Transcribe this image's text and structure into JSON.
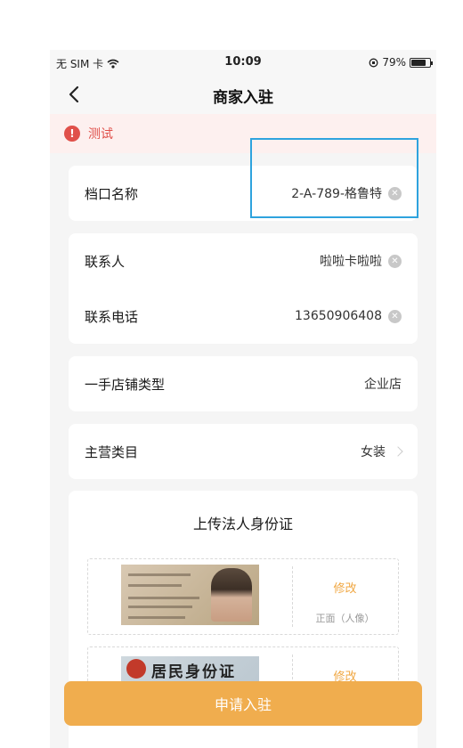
{
  "status_bar": {
    "carrier": "无 SIM 卡",
    "time": "10:09",
    "battery_text": "79%",
    "battery_level": 0.79
  },
  "nav": {
    "title": "商家入驻"
  },
  "notice": {
    "icon_text": "!",
    "text": "测试"
  },
  "stall": {
    "label": "档口名称",
    "value": "2-A-789-格鲁特"
  },
  "contact": {
    "name_label": "联系人",
    "name_value": "啦啦卡啦啦",
    "phone_label": "联系电话",
    "phone_value": "13650906408"
  },
  "shop_type": {
    "label": "一手店铺类型",
    "value": "企业店"
  },
  "category": {
    "label": "主营类目",
    "value": "女装"
  },
  "upload": {
    "title": "上传法人身份证",
    "front": {
      "edit_label": "修改",
      "side_label": "正面（人像）"
    },
    "back": {
      "edit_label": "修改",
      "card_title": "居民身份证"
    }
  },
  "submit_label": "申请入驻",
  "colors": {
    "accent": "#f0ad4e",
    "edit_text": "#f0a742",
    "error": "#e0504a",
    "highlight": "#2ea3de"
  }
}
